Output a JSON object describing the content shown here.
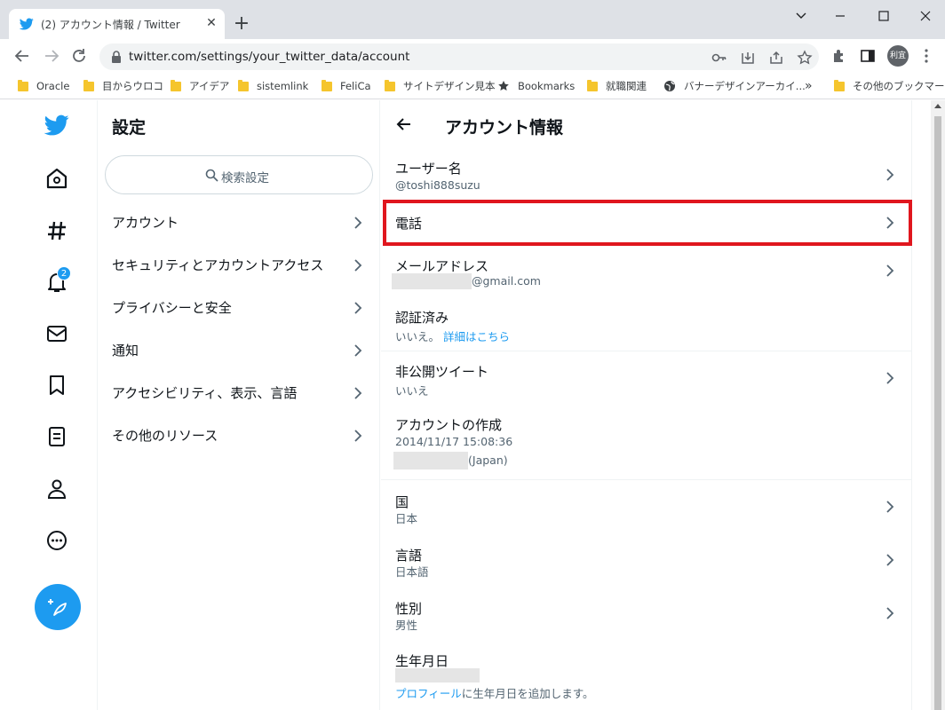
{
  "browser": {
    "tab_title": "(2) アカウント情報 / Twitter",
    "url": "twitter.com/settings/your_twitter_data/account",
    "profile_label": "利宜",
    "bookmarks": [
      "Oracle",
      "目からウロコ",
      "アイデア",
      "sistemlink",
      "FeliCa",
      "サイトデザイン見本",
      "Bookmarks",
      "就職関連",
      "バナーデザインアーカイ..."
    ],
    "bookmarks_overflow": "»",
    "other_bookmarks": "その他のブックマーク"
  },
  "nav": {
    "notification_count": "2"
  },
  "settings": {
    "title": "設定",
    "search_placeholder": "検索設定",
    "items": [
      {
        "label": "アカウント"
      },
      {
        "label": "セキュリティとアカウントアクセス"
      },
      {
        "label": "プライバシーと安全"
      },
      {
        "label": "通知"
      },
      {
        "label": "アクセシビリティ、表示、言語"
      },
      {
        "label": "その他のリソース"
      }
    ]
  },
  "account": {
    "title": "アカウント情報",
    "username_label": "ユーザー名",
    "username_value": "@toshi888suzu",
    "phone_label": "電話",
    "email_label": "メールアドレス",
    "email_suffix": "@gmail.com",
    "verified_label": "認証済み",
    "verified_value": "いいえ。",
    "verified_link": "詳細はこちら",
    "protected_label": "非公開ツイート",
    "protected_value": "いいえ",
    "created_label": "アカウントの作成",
    "created_date": "2014/11/17 15:08:36",
    "created_suffix": "(Japan)",
    "country_label": "国",
    "country_value": "日本",
    "language_label": "言語",
    "language_value": "日本語",
    "gender_label": "性別",
    "gender_value": "男性",
    "birthday_label": "生年月日",
    "birthday_link": "プロフィール",
    "birthday_text": "に生年月日を追加します。"
  },
  "colors": {
    "twitter_blue": "#1d9bf0",
    "highlight_red": "#e0161e"
  }
}
